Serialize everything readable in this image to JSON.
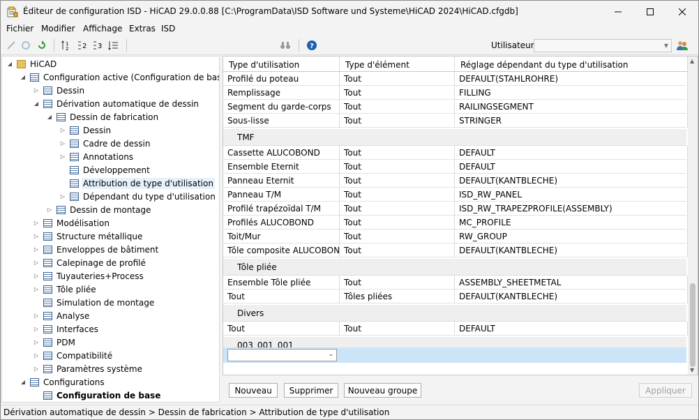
{
  "window": {
    "title": "Éditeur de configuration ISD  - HiCAD 29.0.0.88 [C:\\ProgramData\\ISD Software und Systeme\\HiCAD 2024\\HiCAD.cfgdb]"
  },
  "menu": [
    "Fichier",
    "Modifier",
    "Affichage",
    "Extras",
    "ISD"
  ],
  "toolbar": {
    "user_label": "Utilisateur",
    "user_value": ""
  },
  "tree": [
    {
      "label": "HiCAD",
      "level": 0,
      "exp": "open",
      "icon": "folder-icon"
    },
    {
      "label": "Configuration active (Configuration de base)",
      "level": 1,
      "exp": "open",
      "icon": "table-icon"
    },
    {
      "label": "Dessin",
      "level": 2,
      "exp": "closed",
      "icon": "table-icon"
    },
    {
      "label": "Dérivation automatique de dessin",
      "level": 2,
      "exp": "open",
      "icon": "table-icon"
    },
    {
      "label": "Dessin de fabrication",
      "level": 3,
      "exp": "open",
      "icon": "table-icon"
    },
    {
      "label": "Dessin",
      "level": 4,
      "exp": "closed",
      "icon": "table-icon"
    },
    {
      "label": "Cadre de dessin",
      "level": 4,
      "exp": "closed",
      "icon": "table-icon"
    },
    {
      "label": "Annotations",
      "level": 4,
      "exp": "closed",
      "icon": "table-icon"
    },
    {
      "label": "Développement",
      "level": 4,
      "exp": "none",
      "icon": "table-icon"
    },
    {
      "label": "Attribution de type d'utilisation",
      "level": 4,
      "exp": "none",
      "icon": "table-icon",
      "selected": true
    },
    {
      "label": "Dépendant du type d'utilisation",
      "level": 4,
      "exp": "closed",
      "icon": "table-icon"
    },
    {
      "label": "Dessin de montage",
      "level": 3,
      "exp": "closed",
      "icon": "table-icon"
    },
    {
      "label": "Modélisation",
      "level": 2,
      "exp": "closed",
      "icon": "table-icon"
    },
    {
      "label": "Structure métallique",
      "level": 2,
      "exp": "closed",
      "icon": "table-icon"
    },
    {
      "label": "Enveloppes de bâtiment",
      "level": 2,
      "exp": "closed",
      "icon": "table-icon"
    },
    {
      "label": "Calepinage de profilé",
      "level": 2,
      "exp": "closed",
      "icon": "table-icon"
    },
    {
      "label": "Tuyauteries+Process",
      "level": 2,
      "exp": "closed",
      "icon": "table-icon"
    },
    {
      "label": "Tôle pliée",
      "level": 2,
      "exp": "closed",
      "icon": "table-icon"
    },
    {
      "label": "Simulation de montage",
      "level": 2,
      "exp": "none",
      "icon": "table-icon"
    },
    {
      "label": "Analyse",
      "level": 2,
      "exp": "closed",
      "icon": "table-icon"
    },
    {
      "label": "Interfaces",
      "level": 2,
      "exp": "closed",
      "icon": "table-icon"
    },
    {
      "label": "PDM",
      "level": 2,
      "exp": "closed",
      "icon": "table-icon"
    },
    {
      "label": "Compatibilité",
      "level": 2,
      "exp": "closed",
      "icon": "table-icon"
    },
    {
      "label": "Paramètres système",
      "level": 2,
      "exp": "closed",
      "icon": "table-icon"
    },
    {
      "label": "Configurations",
      "level": 1,
      "exp": "open",
      "icon": "table-icon"
    },
    {
      "label": "Configuration de base",
      "level": 2,
      "exp": "none",
      "icon": "table-icon",
      "bold": true
    }
  ],
  "grid": {
    "headers": [
      "Type d'utilisation",
      "Type d'élément",
      "Réglage dépendant du type d'utilisation"
    ],
    "items": [
      {
        "kind": "row",
        "cells": [
          "Profilé du poteau",
          "Tout",
          "DEFAULT(STAHLROHRE)"
        ]
      },
      {
        "kind": "row",
        "cells": [
          "Remplissage",
          "Tout",
          "FILLING"
        ]
      },
      {
        "kind": "row",
        "cells": [
          "Segment du garde-corps",
          "Tout",
          "RAILINGSEGMENT"
        ]
      },
      {
        "kind": "row",
        "cells": [
          "Sous-lisse",
          "Tout",
          "STRINGER"
        ]
      },
      {
        "kind": "group",
        "label": "TMF"
      },
      {
        "kind": "row",
        "cells": [
          "Cassette ALUCOBOND",
          "Tout",
          "DEFAULT"
        ]
      },
      {
        "kind": "row",
        "cells": [
          "Ensemble Eternit",
          "Tout",
          "DEFAULT"
        ]
      },
      {
        "kind": "row",
        "cells": [
          "Panneau Eternit",
          "Tout",
          "DEFAULT(KANTBLECHE)"
        ]
      },
      {
        "kind": "row",
        "cells": [
          "Panneau T/M",
          "Tout",
          "ISD_RW_PANEL"
        ]
      },
      {
        "kind": "row",
        "cells": [
          "Profilé trapézoïdal T/M",
          "Tout",
          "ISD_RW_TRAPEZPROFILE(ASSEMBLY)"
        ]
      },
      {
        "kind": "row",
        "cells": [
          "Profilés ALUCOBOND",
          "Tout",
          "MC_PROFILE"
        ]
      },
      {
        "kind": "row",
        "cells": [
          "Toit/Mur",
          "Tout",
          "RW_GROUP"
        ]
      },
      {
        "kind": "row",
        "cells": [
          "Tôle composite ALUCOBOND",
          "Tout",
          "DEFAULT(KANTBLECHE)"
        ]
      },
      {
        "kind": "group",
        "label": "Tôle pliée"
      },
      {
        "kind": "row",
        "cells": [
          "Ensemble Tôle pliée",
          "Tout",
          "ASSEMBLY_SHEETMETAL"
        ]
      },
      {
        "kind": "row",
        "cells": [
          "Tout",
          "Tôles pliées",
          "DEFAULT(KANTBLECHE)"
        ]
      },
      {
        "kind": "group",
        "label": "Divers"
      },
      {
        "kind": "row",
        "cells": [
          "Tout",
          "Tout",
          "DEFAULT"
        ]
      },
      {
        "kind": "group",
        "label": "003_001_001"
      }
    ]
  },
  "buttons": {
    "new": "Nouveau",
    "delete": "Supprimer",
    "new_group": "Nouveau groupe",
    "apply": "Appliquer"
  },
  "status": "Dérivation automatique de dessin > Dessin de fabrication > Attribution de type d'utilisation"
}
